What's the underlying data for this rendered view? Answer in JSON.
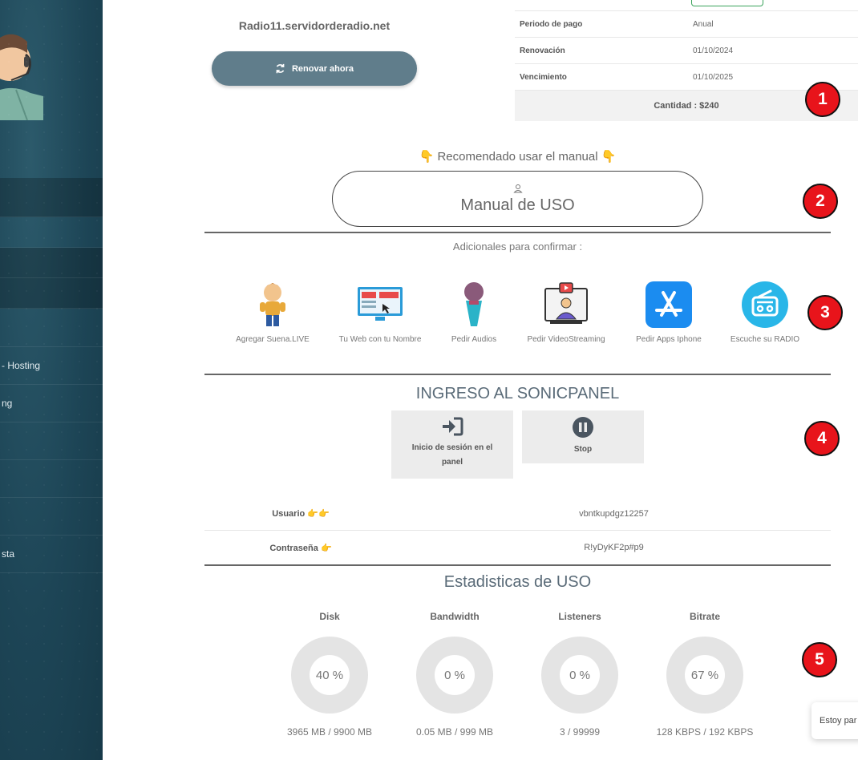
{
  "sidebar": {
    "items": [
      {
        "label": ""
      },
      {
        "label": ""
      },
      {
        "label": ""
      },
      {
        "label": ""
      },
      {
        "label": ""
      },
      {
        "label": "- Hosting"
      },
      {
        "label": "ng"
      },
      {
        "label": ""
      },
      {
        "label": ""
      },
      {
        "label": ""
      },
      {
        "label": "sta"
      },
      {
        "label": ""
      }
    ]
  },
  "subscription": {
    "domain": "Radio11.servidorderadio.net",
    "renew_label": "Renovar ahora",
    "rows": [
      {
        "key": "Periodo de pago",
        "value": "Anual"
      },
      {
        "key": "Renovación",
        "value": "01/10/2024"
      },
      {
        "key": "Vencimiento",
        "value": "01/10/2025"
      }
    ],
    "total": "Cantidad : $240"
  },
  "badges": [
    "1",
    "2",
    "3",
    "4",
    "5"
  ],
  "manual": {
    "recommend": "Recomendado usar el manual",
    "button_label": "Manual de USO"
  },
  "addons": {
    "title": "Adicionales para confirmar :",
    "items": [
      {
        "label": "Agregar Suena.LIVE",
        "icon": "cartoon-character-icon"
      },
      {
        "label": "Tu Web con tu Nombre",
        "icon": "monitor-icon"
      },
      {
        "label": "Pedir Audios",
        "icon": "microphone-icon"
      },
      {
        "label": "Pedir VideoStreaming",
        "icon": "video-presenter-icon"
      },
      {
        "label": "Pedir Apps Iphone",
        "icon": "app-store-icon"
      },
      {
        "label": "Escuche su RADIO",
        "icon": "radio-icon"
      }
    ]
  },
  "sonicpanel": {
    "title": "INGRESO AL SONICPANEL",
    "login_label": "Inicio de sesión en el panel",
    "stop_label": "Stop",
    "user_key": "Usuario",
    "user_value": "vbntkupdgz12257",
    "pass_key": "Contraseña",
    "pass_value": "R!yDyKF2p#p9"
  },
  "stats": {
    "title": "Estadisticas de USO",
    "items": [
      {
        "name": "Disk",
        "percent": "40 %",
        "detail": "3965 MB / 9900 MB"
      },
      {
        "name": "Bandwidth",
        "percent": "0 %",
        "detail": "0.05 MB / 999 MB"
      },
      {
        "name": "Listeners",
        "percent": "0 %",
        "detail": "3 / 99999"
      },
      {
        "name": "Bitrate",
        "percent": "67 %",
        "detail": "128 KBPS / 192 KBPS"
      }
    ]
  },
  "chat": {
    "label": "Estoy par"
  },
  "colors": {
    "sidebar": "#1d4556",
    "renew_button": "#607d8b",
    "badge": "#e8141b",
    "app_store": "#1b8cf0"
  }
}
